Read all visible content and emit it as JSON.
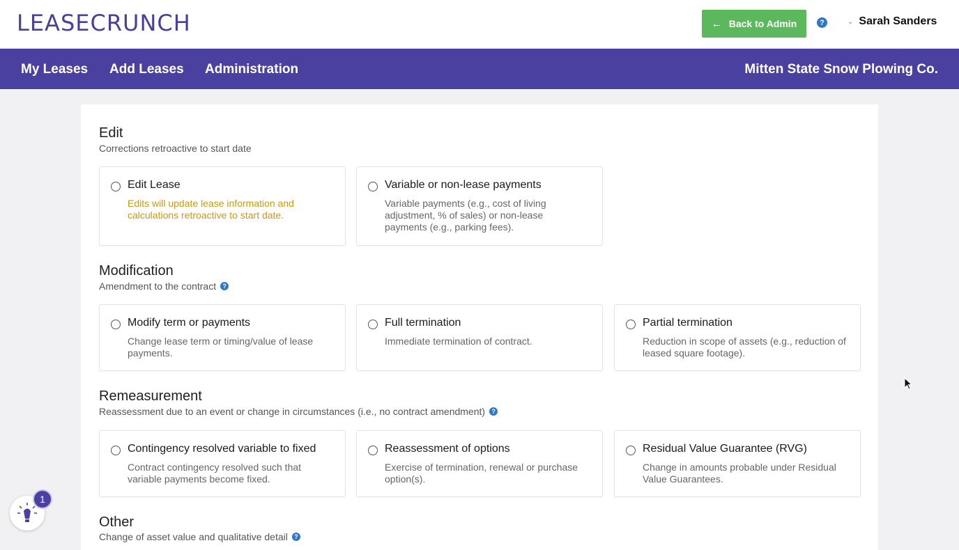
{
  "header": {
    "logo_text": "LEASECRUNCH",
    "back_button_label": "Back to Admin",
    "help_icon": "question-circle-icon",
    "user_name": "Sarah Sanders"
  },
  "nav": {
    "items": [
      "My Leases",
      "Add Leases",
      "Administration"
    ],
    "company": "Mitten State Snow Plowing Co."
  },
  "sections": [
    {
      "title": "Edit",
      "subtitle": "Corrections retroactive to start date",
      "options": [
        {
          "title": "Edit Lease",
          "desc": "Edits will update lease information and calculations retroactive to start date."
        },
        {
          "title": "Variable or non-lease payments",
          "desc": "Variable payments (e.g., cost of living adjustment, % of sales) or non-lease payments (e.g., parking fees)."
        }
      ]
    },
    {
      "title": "Modification",
      "subtitle": "Amendment to the contract",
      "options": [
        {
          "title": "Modify term or payments",
          "desc": "Change lease term or timing/value of lease payments."
        },
        {
          "title": "Full termination",
          "desc": "Immediate termination of contract."
        },
        {
          "title": "Partial termination",
          "desc": "Reduction in scope of assets (e.g., reduction of leased square footage)."
        }
      ]
    },
    {
      "title": "Remeasurement",
      "subtitle": "Reassessment due to an event or change in circumstances (i.e., no contract amendment)",
      "options": [
        {
          "title": "Contingency resolved variable to fixed",
          "desc": "Contract contingency resolved such that variable payments become fixed."
        },
        {
          "title": "Reassessment of options",
          "desc": "Exercise of termination, renewal or purchase option(s)."
        },
        {
          "title": "Residual Value Guarantee (RVG)",
          "desc": "Change in amounts probable under Residual Value Guarantees."
        }
      ]
    },
    {
      "title": "Other",
      "subtitle": "Change of asset value and qualitative detail"
    }
  ],
  "helper": {
    "badge_count": "1"
  },
  "colors": {
    "brand": "#4a40a0",
    "action": "#5cb85c",
    "warning_text": "#c99a10",
    "help": "#2e78c7"
  }
}
